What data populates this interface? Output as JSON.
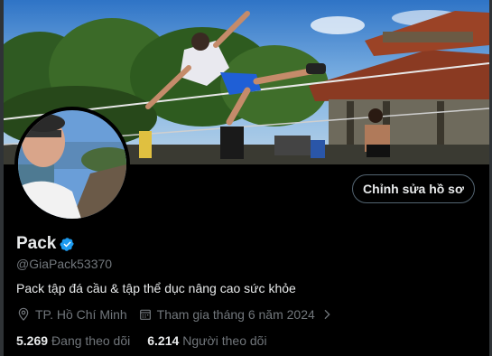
{
  "profile": {
    "name": "Pack",
    "handle": "@GiaPack53370",
    "bio": "Pack tập đá cầu & tập thể dục nâng cao sức khỏe",
    "location": "TP. Hồ Chí Minh",
    "joined": "Tham gia tháng 6 năm 2024",
    "following_count": "5.269",
    "following_label": "Đang theo dõi",
    "followers_count": "6.214",
    "followers_label": "Người theo dõi"
  },
  "actions": {
    "edit_profile_label": "Chỉnh sửa hồ sơ"
  },
  "colors": {
    "background": "#000000",
    "text_primary": "#e7e9ea",
    "text_secondary": "#71767b",
    "verified_badge": "#1d9bf0",
    "button_border": "#536471"
  },
  "icons": {
    "verified": "verified-badge-icon",
    "location": "location-pin-icon",
    "calendar": "calendar-icon",
    "chevron": "chevron-right-icon"
  }
}
